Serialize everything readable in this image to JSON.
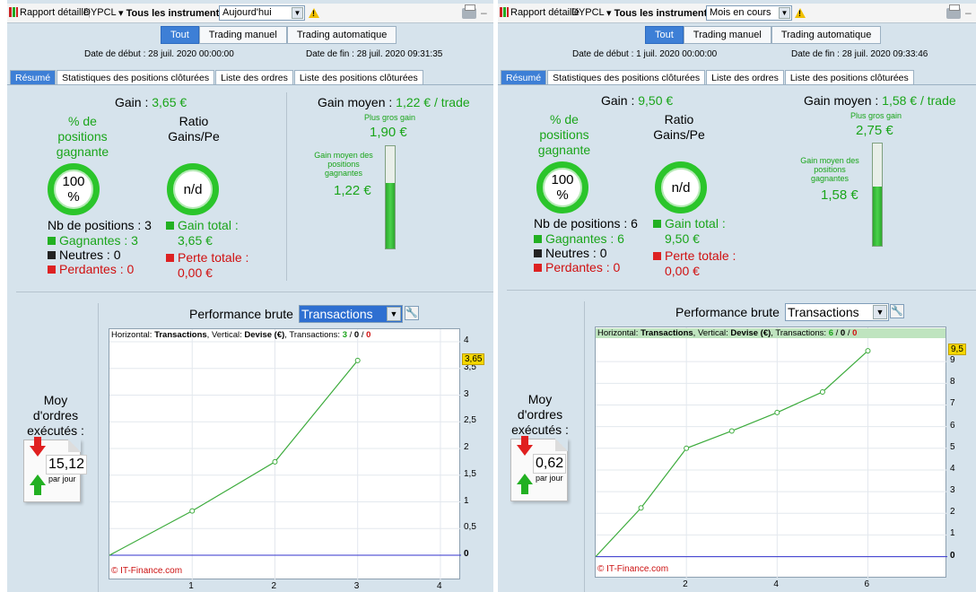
{
  "panels": [
    {
      "toolbar": {
        "report_label": "Rapport détaillé",
        "account": "DYPCL",
        "instruments": "Tous les instruments",
        "period": "Aujourd'hui"
      },
      "mode_tabs": [
        "Tout",
        "Trading manuel",
        "Trading automatique"
      ],
      "active_mode": "Tout",
      "start_date": "Date de début : 28 juil. 2020 00:00:00",
      "end_date": "Date de fin : 28 juil. 2020 09:31:35",
      "section_tabs": [
        "Résumé",
        "Statistiques des positions clôturées",
        "Liste des ordres",
        "Liste des positions clôturées"
      ],
      "gain_label": "Gain :",
      "gain_value": "3,65 €",
      "pct_label": "% de positions gagnante",
      "pct_value": "100 %",
      "ratio_label": "Ratio Gains/Pe",
      "ratio_value": "n/d",
      "nb_positions": "Nb de positions : 3",
      "gagnantes": "Gagnantes : 3",
      "neutres": "Neutres : 0",
      "perdantes": "Perdantes : 0",
      "gain_total_label": "Gain total :",
      "gain_total_value": "3,65 €",
      "perte_totale_label": "Perte totale :",
      "perte_totale_value": "0,00 €",
      "gain_moyen_label": "Gain moyen :",
      "gain_moyen_value": "1,22 € / trade",
      "plus_gros_label": "Plus gros gain",
      "plus_gros_value": "1,90 €",
      "gain_moyen_pos_label": "Gain moyen des positions gagnantes",
      "gain_moyen_pos_value": "1,22 €",
      "bar_fill_fraction": 0.64,
      "perf_label": "Performance brute",
      "perf_select": "Transactions",
      "moy_label": "Moy d'ordres exécutés :",
      "moy_value": "15,12",
      "moy_unit": "par jour",
      "colors": {
        "gain": "#1aa51a",
        "loss": "#d01010",
        "accent": "#3d7fd6",
        "line": "#3cab3c",
        "zero": "#3333cc"
      },
      "chart_data": {
        "type": "line",
        "info_prefix": "Horizontal: ",
        "info_h": "Transactions",
        "info_mid": ", Vertical: ",
        "info_v": "Devise (€)",
        "info_tx": ", Transactions: ",
        "count_win": "3",
        "count_neutral": "0",
        "count_loss": "0",
        "copyright": "© IT-Finance.com",
        "x": [
          0,
          1,
          2,
          3
        ],
        "values": [
          0,
          0.83,
          1.75,
          3.65
        ],
        "xlim": [
          0,
          4.25
        ],
        "ylim": [
          -0.1,
          4
        ],
        "xticks": [
          "1",
          "2",
          "3",
          "4"
        ],
        "xtick_values": [
          1,
          2,
          3,
          4
        ],
        "yticks": [
          "4",
          "3,5",
          "3",
          "2,5",
          "2",
          "1,5",
          "1",
          "0,5",
          "0"
        ],
        "ytick_values": [
          4,
          3.5,
          3,
          2.5,
          2,
          1.5,
          1,
          0.5,
          0
        ],
        "current_value": "3,65",
        "current": 3.65
      }
    },
    {
      "toolbar": {
        "report_label": "Rapport détaillé",
        "account": "DYPCL",
        "instruments": "Tous les instruments",
        "period": "Mois en cours"
      },
      "mode_tabs": [
        "Tout",
        "Trading manuel",
        "Trading automatique"
      ],
      "active_mode": "Tout",
      "start_date": "Date de début : 1 juil. 2020 00:00:00",
      "end_date": "Date de fin : 28 juil. 2020 09:33:46",
      "section_tabs": [
        "Résumé",
        "Statistiques des positions clôturées",
        "Liste des ordres",
        "Liste des positions clôturées"
      ],
      "gain_label": "Gain :",
      "gain_value": "9,50 €",
      "pct_label": "% de positions gagnante",
      "pct_value": "100 %",
      "ratio_label": "Ratio Gains/Pe",
      "ratio_value": "n/d",
      "nb_positions": "Nb de positions : 6",
      "gagnantes": "Gagnantes : 6",
      "neutres": "Neutres : 0",
      "perdantes": "Perdantes : 0",
      "gain_total_label": "Gain total :",
      "gain_total_value": "9,50 €",
      "perte_totale_label": "Perte totale :",
      "perte_totale_value": "0,00 €",
      "gain_moyen_label": "Gain moyen :",
      "gain_moyen_value": "1,58 € / trade",
      "plus_gros_label": "Plus gros gain",
      "plus_gros_value": "2,75 €",
      "gain_moyen_pos_label": "Gain moyen des positions gagnantes",
      "gain_moyen_pos_value": "1,58 €",
      "bar_fill_fraction": 0.58,
      "perf_label": "Performance brute",
      "perf_select": "Transactions",
      "moy_label": "Moy d'ordres exécutés :",
      "moy_value": "0,62",
      "moy_unit": "par jour",
      "colors": {
        "gain": "#1aa51a",
        "loss": "#d01010",
        "accent": "#3d7fd6",
        "line": "#3cab3c",
        "zero": "#3333cc"
      },
      "chart_data": {
        "type": "line",
        "info_prefix": "Horizontal: ",
        "info_h": "Transactions",
        "info_mid": ", Vertical: ",
        "info_v": "Devise (€)",
        "info_tx": ", Transactions: ",
        "count_win": "6",
        "count_neutral": "0",
        "count_loss": "0",
        "copyright": "© IT-Finance.com",
        "x": [
          0,
          1,
          2,
          3,
          4,
          5,
          6
        ],
        "values": [
          0,
          2.25,
          5.0,
          5.8,
          6.65,
          7.6,
          9.5
        ],
        "xlim": [
          0,
          7.75
        ],
        "ylim": [
          -0.1,
          10
        ],
        "xticks": [
          "2",
          "4",
          "6"
        ],
        "xtick_values": [
          2,
          4,
          6
        ],
        "yticks": [
          "9",
          "8",
          "7",
          "6",
          "5",
          "4",
          "3",
          "2",
          "1",
          "0"
        ],
        "ytick_values": [
          9,
          8,
          7,
          6,
          5,
          4,
          3,
          2,
          1,
          0
        ],
        "current_value": "9,5",
        "current": 9.5
      }
    }
  ]
}
